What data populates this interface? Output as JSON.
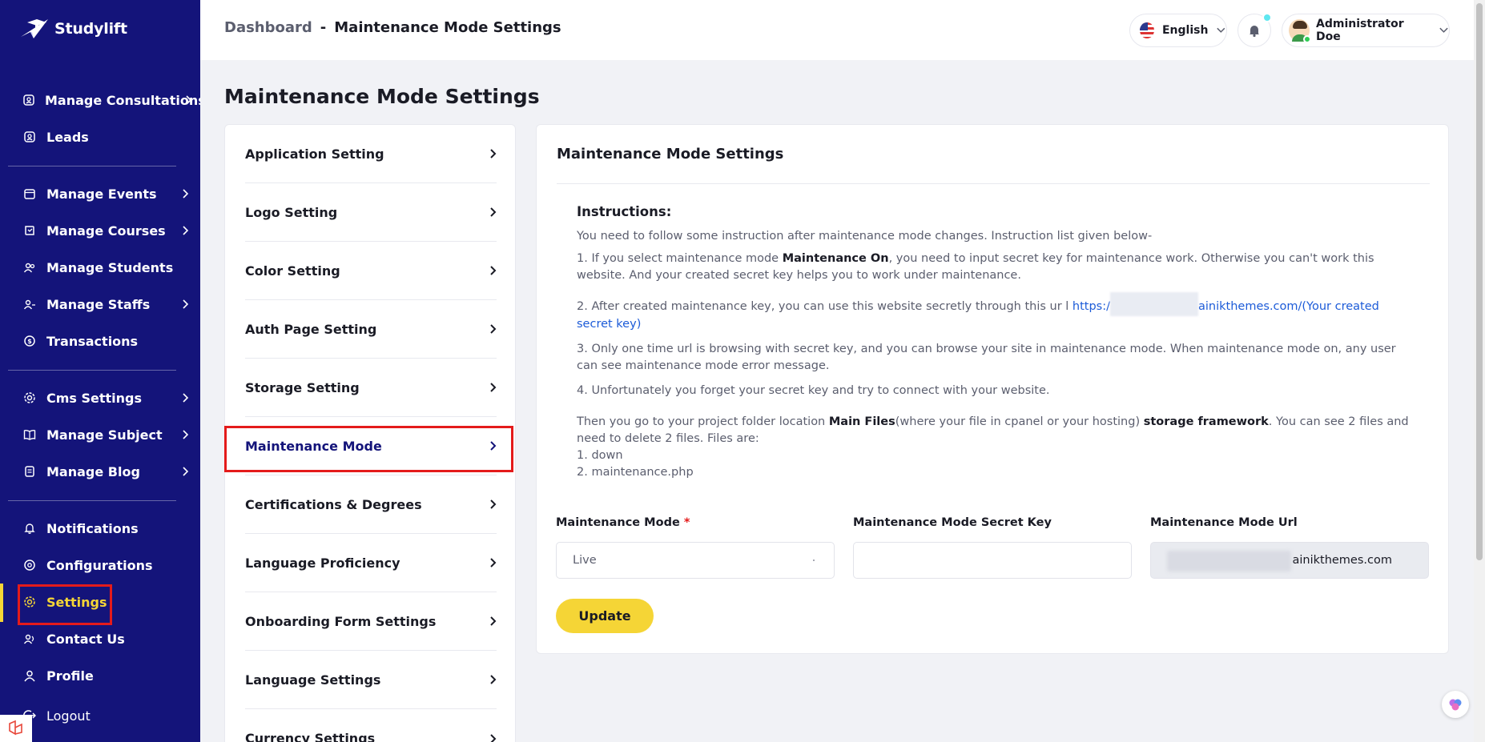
{
  "brand": {
    "name": "Studylift"
  },
  "sidebar": {
    "items": [
      {
        "label": "Manage Consultations",
        "icon": "calendar-user-icon",
        "chevron": true
      },
      {
        "label": "Leads",
        "icon": "contact-card-icon",
        "chevron": false
      },
      {
        "label": "Manage Events",
        "icon": "calendar-icon",
        "chevron": true
      },
      {
        "label": "Manage Courses",
        "icon": "book-icon",
        "chevron": true
      },
      {
        "label": "Manage Students",
        "icon": "students-icon",
        "chevron": false
      },
      {
        "label": "Manage Staffs",
        "icon": "staff-icon",
        "chevron": true
      },
      {
        "label": "Transactions",
        "icon": "transaction-icon",
        "chevron": false
      },
      {
        "label": "Cms Settings",
        "icon": "gear-icon",
        "chevron": true
      },
      {
        "label": "Manage Subject",
        "icon": "open-book-icon",
        "chevron": true
      },
      {
        "label": "Manage Blog",
        "icon": "document-icon",
        "chevron": true
      },
      {
        "label": "Notifications",
        "icon": "bell-icon",
        "chevron": false
      },
      {
        "label": "Configurations",
        "icon": "config-icon",
        "chevron": false
      },
      {
        "label": "Settings",
        "icon": "gear-icon",
        "chevron": false,
        "active": true
      },
      {
        "label": "Contact Us",
        "icon": "contacts-icon",
        "chevron": false
      },
      {
        "label": "Profile",
        "icon": "user-icon",
        "chevron": false
      },
      {
        "label": "Logout",
        "icon": "logout-icon",
        "chevron": false
      }
    ]
  },
  "header": {
    "breadcrumb_root": "Dashboard",
    "breadcrumb_sep": "-",
    "breadcrumb_current": "Maintenance Mode Settings",
    "language": "English",
    "user_name": "Administrator Doe"
  },
  "page_title": "Maintenance Mode Settings",
  "settings_menu": [
    {
      "label": "Application Setting"
    },
    {
      "label": "Logo Setting"
    },
    {
      "label": "Color Setting"
    },
    {
      "label": "Auth Page Setting"
    },
    {
      "label": "Storage Setting"
    },
    {
      "label": "Maintenance Mode",
      "selected": true
    },
    {
      "label": "Certifications & Degrees"
    },
    {
      "label": "Language Proficiency"
    },
    {
      "label": "Onboarding Form Settings"
    },
    {
      "label": "Language Settings"
    },
    {
      "label": "Currency Settings"
    }
  ],
  "card": {
    "title": "Maintenance Mode Settings",
    "instructions_title": "Instructions:",
    "intro": "You need to follow some instruction after maintenance mode changes. Instruction list given below-",
    "step1_a": "1. If you select maintenance mode ",
    "step1_bold": "Maintenance On",
    "step1_b": ", you need to input secret key for maintenance work. Otherwise you can't work this website. And your created secret key helps you to work under maintenance.",
    "step2_a": "2. After created maintenance key, you can use this website secretly through this ur l ",
    "step2_link_a": "https:/",
    "step2_link_b": "ainikthemes.com/(Your created secret key)",
    "step3": "3. Only one time url is browsing with secret key, and you can browse your site in maintenance mode. When maintenance mode on, any user can see maintenance mode error message.",
    "step4": "4. Unfortunately you forget your secret key and try to connect with your website.",
    "then_a": "Then you go to your project folder location ",
    "then_bold1": "Main Files",
    "then_b": "(where your file in cpanel or your hosting) ",
    "then_bold2": "storage framework",
    "then_c": ". You can see 2 files and need to delete 2 files. Files are:",
    "file1": "1. down",
    "file2": "2. maintenance.php"
  },
  "form": {
    "mode_label": "Maintenance Mode",
    "required_mark": "*",
    "mode_value": "Live",
    "secret_label": "Maintenance Mode Secret Key",
    "secret_value": "",
    "url_label": "Maintenance Mode Url",
    "url_value": "ainikthemes.com",
    "update_label": "Update"
  },
  "colors": {
    "sidebar_bg": "#14147a",
    "accent_yellow": "#f5d536",
    "highlight_red": "#e41b1b",
    "link_blue": "#1c5bd8"
  }
}
